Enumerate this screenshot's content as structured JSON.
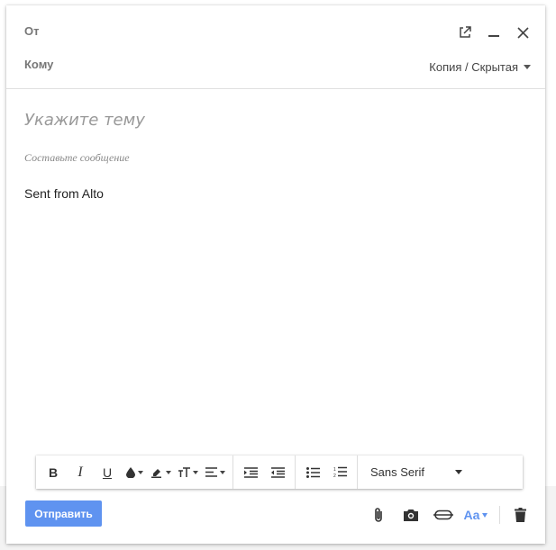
{
  "header": {
    "from_label": "От",
    "to_label": "Кому",
    "cc_bcc_label": "Копия / Скрытая"
  },
  "window_icons": [
    "popout-icon",
    "minimize-icon",
    "close-icon"
  ],
  "compose": {
    "subject_placeholder": "Укажите тему",
    "body_placeholder": "Составьте сообщение",
    "signature": "Sent from Alto"
  },
  "toolbar": {
    "bold": "B",
    "italic": "I",
    "underline": "U",
    "font_name": "Sans Serif"
  },
  "footer": {
    "send_label": "Отправить",
    "font_format_label": "Aa"
  },
  "colors": {
    "accent": "#5f93f0",
    "placeholder": "#999999"
  }
}
